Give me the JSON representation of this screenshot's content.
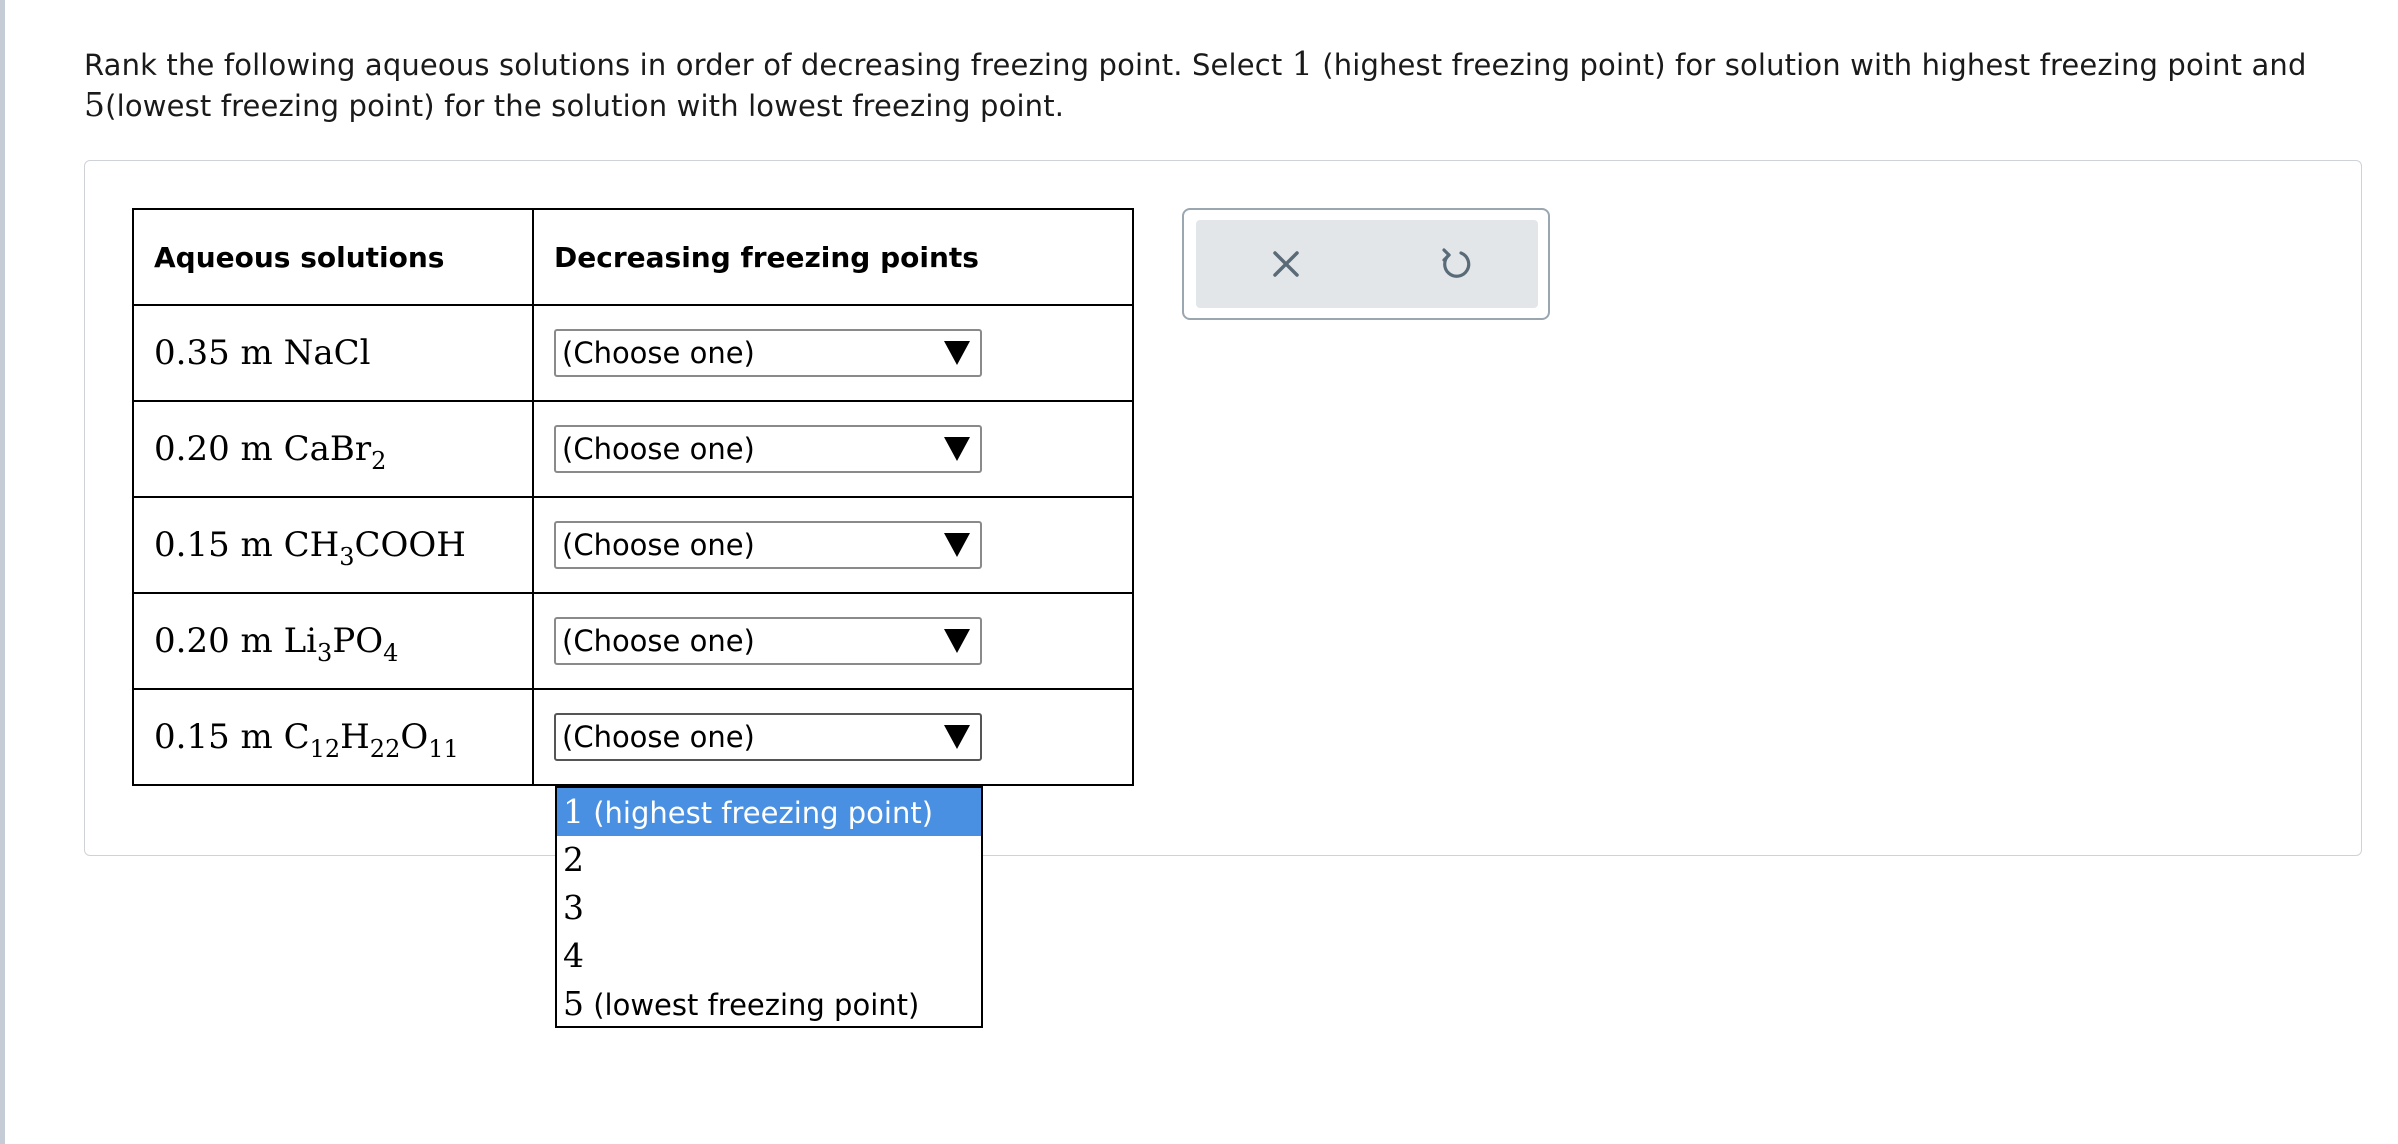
{
  "prompt": {
    "part1": "Rank the following aqueous solutions in order of decreasing freezing point. Select ",
    "one": "1",
    "part2": " (highest freezing point) for solution with highest freezing point and ",
    "five": "5",
    "part3": "(lowest freezing point) for the solution with lowest freezing point."
  },
  "table": {
    "headers": [
      "Aqueous solutions",
      "Decreasing freezing points"
    ],
    "rows": [
      {
        "amount": "0.35 m",
        "formula": [
          "NaCl"
        ],
        "selected": "(Choose one)"
      },
      {
        "amount": "0.20 m",
        "formula": [
          "CaBr",
          "2"
        ],
        "selected": "(Choose one)"
      },
      {
        "amount": "0.15 m",
        "formula": [
          "CH",
          "3",
          "COOH"
        ],
        "selected": "(Choose one)"
      },
      {
        "amount": "0.20 m",
        "formula": [
          "Li",
          "3",
          "PO",
          "4"
        ],
        "selected": "(Choose one)"
      },
      {
        "amount": "0.15 m",
        "formula": [
          "C",
          "12",
          "H",
          "22",
          "O",
          "11"
        ],
        "selected": "(Choose one)"
      }
    ]
  },
  "dropdown": {
    "options": [
      {
        "num": "1",
        "label": " (highest freezing point)",
        "highlighted": true
      },
      {
        "num": "2",
        "label": ""
      },
      {
        "num": "3",
        "label": ""
      },
      {
        "num": "4",
        "label": ""
      },
      {
        "num": "5",
        "label": " (lowest freezing point)"
      }
    ]
  },
  "tools": {
    "icons": [
      "close-icon",
      "undo-icon"
    ]
  },
  "colors": {
    "highlight": "#4a90e2",
    "tool_bg": "#e2e6e9",
    "tool_border": "#9aa7b1",
    "icon": "#5a6b78"
  }
}
